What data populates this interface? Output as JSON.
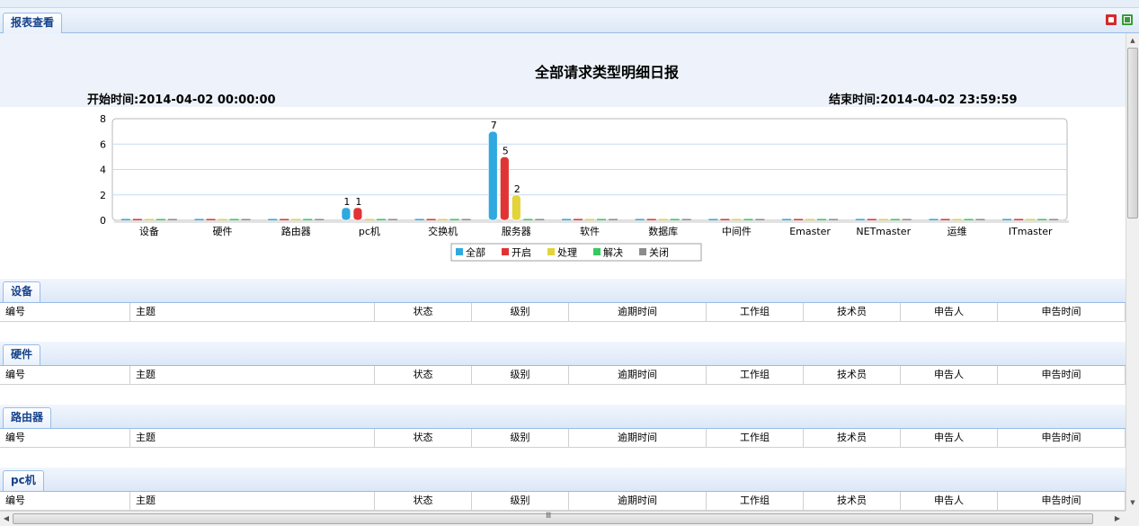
{
  "window": {
    "tab_label": "报表查看"
  },
  "toolbar": {
    "icons": [
      "pdf-export-icon",
      "excel-export-icon"
    ]
  },
  "report": {
    "title": "全部请求类型明细日报",
    "start_time": "开始时间:2014-04-02 00:00:00",
    "end_time": "结束时间:2014-04-02 23:59:59"
  },
  "chart_data": {
    "type": "bar",
    "title": "",
    "categories": [
      "设备",
      "硬件",
      "路由器",
      "pc机",
      "交换机",
      "服务器",
      "软件",
      "数据库",
      "中间件",
      "Emaster",
      "NETmaster",
      "运维",
      "ITmaster"
    ],
    "series": [
      {
        "name": "全部",
        "color": "#2fa9e0",
        "values": [
          0,
          0,
          0,
          1,
          0,
          7,
          0,
          0,
          0,
          0,
          0,
          0,
          0
        ]
      },
      {
        "name": "开启",
        "color": "#e03434",
        "values": [
          0,
          0,
          0,
          1,
          0,
          5,
          0,
          0,
          0,
          0,
          0,
          0,
          0
        ]
      },
      {
        "name": "处理",
        "color": "#e2d43a",
        "values": [
          0,
          0,
          0,
          0,
          0,
          2,
          0,
          0,
          0,
          0,
          0,
          0,
          0
        ]
      },
      {
        "name": "解决",
        "color": "#35c960",
        "values": [
          0,
          0,
          0,
          0,
          0,
          0,
          0,
          0,
          0,
          0,
          0,
          0,
          0
        ]
      },
      {
        "name": "关闭",
        "color": "#8c8c8c",
        "values": [
          0,
          0,
          0,
          0,
          0,
          0,
          0,
          0,
          0,
          0,
          0,
          0,
          0
        ]
      }
    ],
    "y_ticks": [
      "8",
      "6",
      "4",
      "2",
      "0"
    ],
    "ylim": [
      0,
      8
    ],
    "grid": true,
    "legend": "bottom-center"
  },
  "table_columns": [
    "编号",
    "主题",
    "状态",
    "级别",
    "逾期时间",
    "工作组",
    "技术员",
    "申告人",
    "申告时间"
  ],
  "sections": [
    {
      "label": "设备"
    },
    {
      "label": "硬件"
    },
    {
      "label": "路由器"
    },
    {
      "label": "pc机"
    }
  ],
  "scrollbar": {
    "vertical_position": 0.0,
    "horizontal_grip": "Ⅲ"
  }
}
